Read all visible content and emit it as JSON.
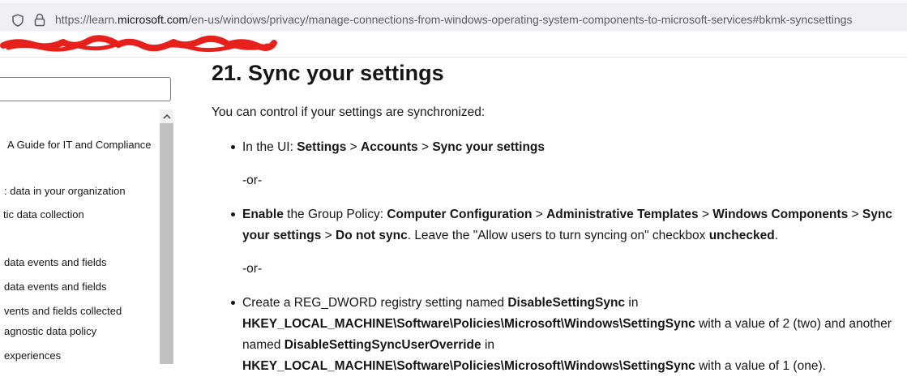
{
  "browser": {
    "url_prefix": "https://learn.",
    "url_host": "microsoft.com",
    "url_path": "/en-us/windows/privacy/manage-connections-from-windows-operating-system-components-to-microsoft-services#bkmk-syncsettings"
  },
  "sidebar": {
    "filter_value": "",
    "items": [
      "A Guide for IT and Compliance",
      ": data in your organization",
      "tic data collection",
      " data events and fields",
      " data events and fields",
      "vents and fields collected",
      "agnostic data policy",
      "experiences"
    ]
  },
  "article": {
    "title": "21. Sync your settings",
    "intro": "You can control if your settings are synchronized:",
    "ui_step": {
      "prefix": "In the UI: ",
      "p1": "Settings",
      "sep1": " > ",
      "p2": "Accounts",
      "sep2": " > ",
      "p3": "Sync your settings"
    },
    "or_1": "-or-",
    "gp_step": {
      "enable": "Enable",
      "t1": " the Group Policy: ",
      "p1": "Computer Configuration",
      "s1": " > ",
      "p2": "Administrative Templates",
      "s2": " > ",
      "p3": "Windows Components",
      "s3": " > ",
      "p4": "Sync your settings",
      "s4": " > ",
      "p5": "Do not sync",
      "t2": ". Leave the \"Allow users to turn syncing on\" checkbox ",
      "p6": "unchecked",
      "t3": "."
    },
    "or_2": "-or-",
    "reg_step": {
      "t1": "Create a REG_DWORD registry setting named ",
      "b1": "DisableSettingSync",
      "t2": " in ",
      "b2": "HKEY_LOCAL_MACHINE\\Software\\Policies\\Microsoft\\Windows\\SettingSync",
      "t3": " with a value of 2 (two) and another named ",
      "b3": "DisableSettingSyncUserOverride",
      "t4": " in ",
      "b4": "HKEY_LOCAL_MACHINE\\Software\\Policies\\Microsoft\\Windows\\SettingSync",
      "t5": " with a value of 1 (one)."
    }
  }
}
